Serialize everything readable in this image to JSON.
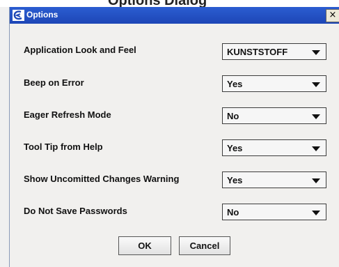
{
  "page": {
    "top_text": "Options Dialog"
  },
  "dialog": {
    "title": "Options",
    "close_glyph": "×"
  },
  "options": [
    {
      "label": "Application Look and Feel",
      "value": "KUNSTSTOFF"
    },
    {
      "label": "Beep on Error",
      "value": "Yes"
    },
    {
      "label": "Eager Refresh Mode",
      "value": "No"
    },
    {
      "label": "Tool Tip from Help",
      "value": "Yes"
    },
    {
      "label": "Show Uncomitted Changes Warning",
      "value": "Yes"
    },
    {
      "label": "Do Not Save Passwords",
      "value": "No"
    }
  ],
  "buttons": {
    "ok": "OK",
    "cancel": "Cancel"
  },
  "colors": {
    "titlebar": "#1d46b6",
    "dialog_bg": "#f1f0ee"
  },
  "icons": {
    "title": "app-logo-icon",
    "close": "close-icon",
    "dropdown": "chevron-down-icon"
  }
}
